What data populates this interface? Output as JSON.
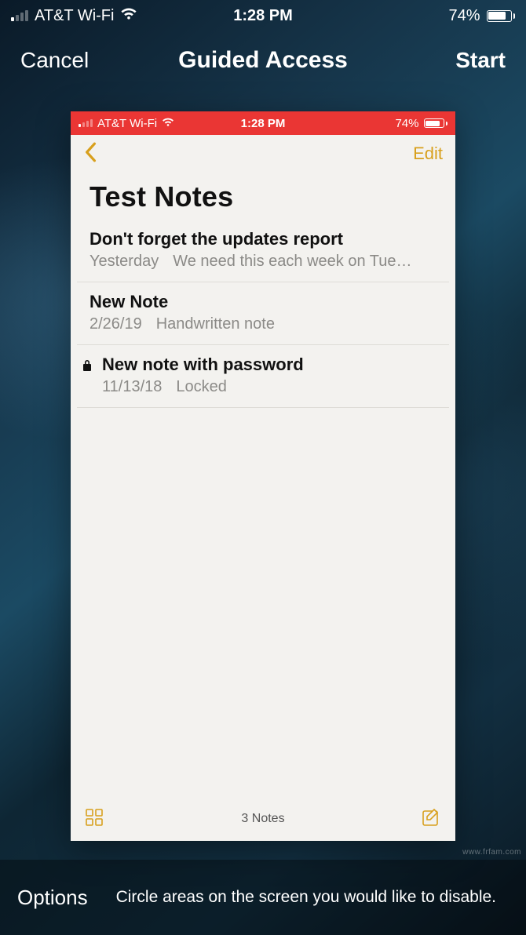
{
  "outer_status": {
    "carrier": "AT&T Wi-Fi",
    "time": "1:28 PM",
    "battery_pct": "74%",
    "battery_fill_pct": 74
  },
  "guided_access": {
    "cancel": "Cancel",
    "title": "Guided Access",
    "start": "Start"
  },
  "inner_status": {
    "carrier": "AT&T Wi-Fi",
    "time": "1:28 PM",
    "battery_pct": "74%",
    "battery_fill_pct": 74
  },
  "notes": {
    "edit": "Edit",
    "folder_title": "Test Notes",
    "items": [
      {
        "title": "Don't forget the updates report",
        "date": "Yesterday",
        "summary": "We need this each week on Tue…",
        "locked": false
      },
      {
        "title": "New Note",
        "date": "2/26/19",
        "summary": "Handwritten note",
        "locked": false
      },
      {
        "title": "New note with password",
        "date": "11/13/18",
        "summary": "Locked",
        "locked": true
      }
    ],
    "footer_count": "3 Notes"
  },
  "options_bar": {
    "label": "Options",
    "hint": "Circle areas on the screen you would like to disable."
  },
  "watermark": "www.frfam.com",
  "colors": {
    "accent_yellow": "#d8a01d",
    "red_status": "#ea3634"
  }
}
